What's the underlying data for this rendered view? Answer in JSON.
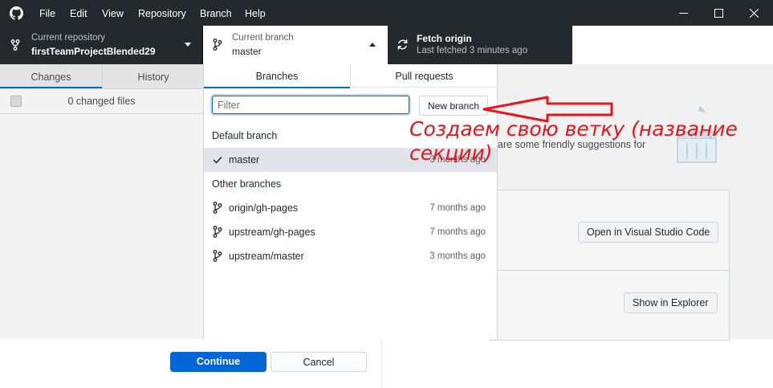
{
  "menu": [
    "File",
    "Edit",
    "View",
    "Repository",
    "Branch",
    "Help"
  ],
  "toolbar": {
    "repo_label": "Current repository",
    "repo_value": "firstTeamProjectBlended29",
    "branch_label": "Current branch",
    "branch_value": "master",
    "fetch_label": "Fetch origin",
    "fetch_sub": "Last fetched 3 minutes ago"
  },
  "left": {
    "tab_changes": "Changes",
    "tab_history": "History",
    "changed_files": "0 changed files"
  },
  "dropdown": {
    "tab_branches": "Branches",
    "tab_pull_requests": "Pull requests",
    "filter_placeholder": "Filter",
    "new_branch": "New branch",
    "default_heading": "Default branch",
    "other_heading": "Other branches",
    "default_branches": [
      {
        "name": "master",
        "time": "3 months ago"
      }
    ],
    "other_branches": [
      {
        "name": "origin/gh-pages",
        "time": "7 months ago"
      },
      {
        "name": "upstream/gh-pages",
        "time": "7 months ago"
      },
      {
        "name": "upstream/master",
        "time": "3 months ago"
      }
    ]
  },
  "main": {
    "friendly_text": "are some friendly suggestions for",
    "open_vscode": "Open in Visual Studio Code",
    "show_explorer": "Show in Explorer"
  },
  "dialog": {
    "continue": "Continue",
    "cancel": "Cancel"
  },
  "annotation": {
    "text": "Создаем свою ветку (название секции)",
    "color": "#e8141a"
  },
  "colors": {
    "titlebar": "#24292e",
    "accent": "#0366d6"
  }
}
